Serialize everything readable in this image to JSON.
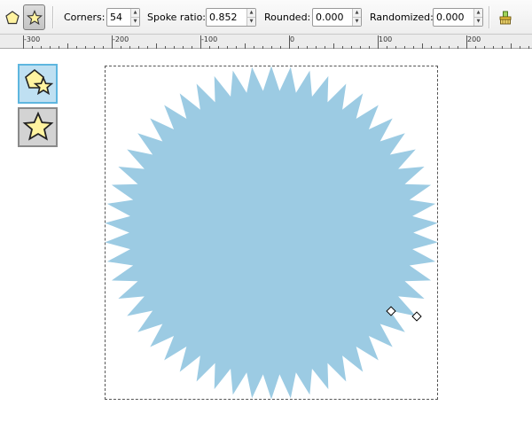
{
  "toolbar": {
    "corners_label": "Corners:",
    "corners_value": "54",
    "spoke_label": "Spoke ratio:",
    "spoke_value": "0.852",
    "rounded_label": "Rounded:",
    "rounded_value": "0.000",
    "randomized_label": "Randomized:",
    "randomized_value": "0.000",
    "icons": [
      "polygon-icon",
      "star-icon",
      "reset-defaults-icon"
    ]
  },
  "ruler": {
    "labels": [
      "-300",
      "-200",
      "-100",
      "0",
      "100",
      "200"
    ]
  },
  "canvas": {
    "shape_fill": "#9ccbe3",
    "style_buttons": [
      "polygon-and-star-icon",
      "star-icon"
    ]
  }
}
